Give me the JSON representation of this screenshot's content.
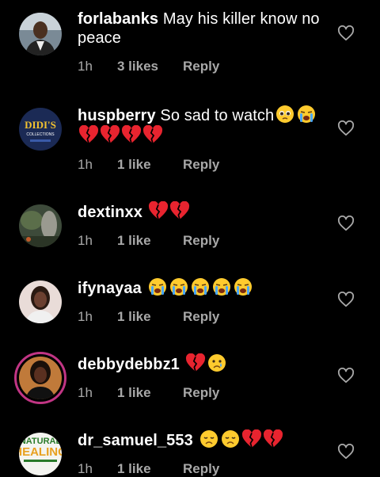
{
  "comments": [
    {
      "username": "forlabanks",
      "text": "May his killer know no peace",
      "time": "1h",
      "likes": "3 likes",
      "reply": "Reply",
      "emojis": []
    },
    {
      "username": "huspberry",
      "text": "So sad to watch",
      "time": "1h",
      "likes": "1 like",
      "reply": "Reply",
      "emojis": [
        "pleading-face",
        "crying-face",
        "broken-heart",
        "broken-heart",
        "broken-heart",
        "broken-heart"
      ]
    },
    {
      "username": "dextinxx",
      "text": "",
      "time": "1h",
      "likes": "1 like",
      "reply": "Reply",
      "emojis": [
        "broken-heart",
        "broken-heart"
      ]
    },
    {
      "username": "ifynayaa",
      "text": "",
      "time": "1h",
      "likes": "1 like",
      "reply": "Reply",
      "emojis": [
        "crying-face",
        "crying-face",
        "crying-face",
        "crying-face",
        "crying-face"
      ]
    },
    {
      "username": "debbydebbz1",
      "text": "",
      "time": "1h",
      "likes": "1 like",
      "reply": "Reply",
      "emojis": [
        "broken-heart",
        "sad-tear-face"
      ]
    },
    {
      "username": "dr_samuel_553",
      "text": "",
      "time": "1h",
      "likes": "1 like",
      "reply": "Reply",
      "emojis": [
        "disappointed-face",
        "disappointed-face",
        "broken-heart",
        "broken-heart"
      ]
    }
  ],
  "avatars": {
    "huspberry_brand": "DIDI'S",
    "huspberry_sub": "COLLECTIONS",
    "dr_samuel_top": "NATURAL",
    "dr_samuel_bottom": "HEALING"
  },
  "colors": {
    "background": "#000000",
    "text": "#ffffff",
    "meta": "#a8a8a8",
    "story_ring": "#c13584"
  }
}
